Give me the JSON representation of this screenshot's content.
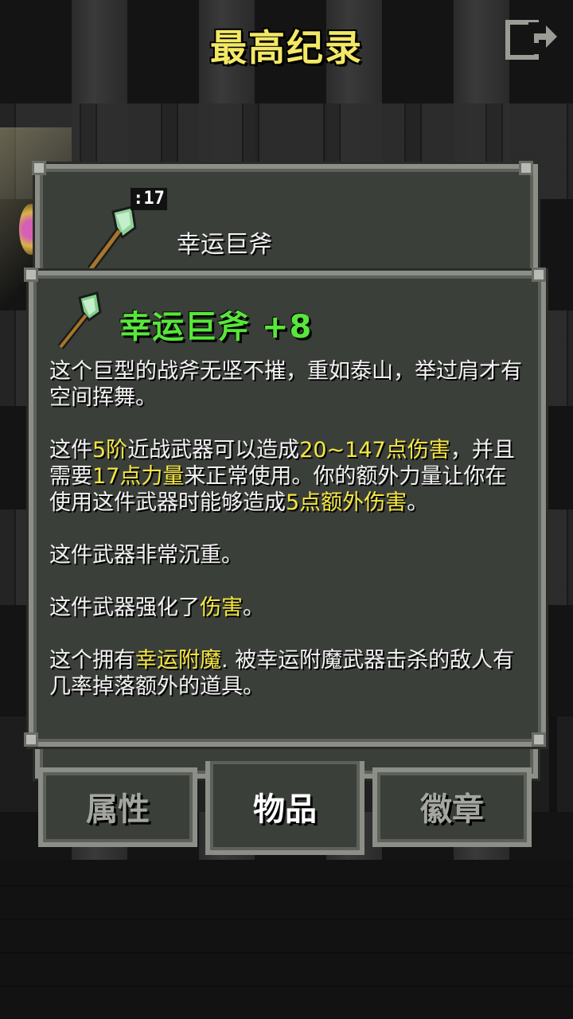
{
  "header": {
    "title": "最高纪录",
    "exit_icon": "exit-door-icon"
  },
  "back_panel": {
    "item_name": "幸运巨斧",
    "badge": ":17",
    "item_icon": "greataxe-icon"
  },
  "item": {
    "title": "幸运巨斧 +8",
    "icon": "greataxe-icon",
    "desc1": "这个巨型的战斧无坚不摧，重如泰山，举过肩才有空间挥舞。",
    "d2_a": "这件",
    "d2_tier": "5阶",
    "d2_b": "近战武器可以造成",
    "d2_dmg": "20~147点伤害",
    "d2_c": "，并且需要",
    "d2_str": "17点力量",
    "d2_d": "来正常使用。你的额外力量让你在使用这件武器时能够造成",
    "d2_bonus": "5点额外伤害",
    "d2_e": "。",
    "desc3": "这件武器非常沉重。",
    "d4_a": "这件武器强化了",
    "d4_hl": "伤害",
    "d4_b": "。",
    "d5_a": "这个拥有",
    "d5_hl": "幸运附魔",
    "d5_b": ". 被幸运附魔武器击杀的敌人有几率掉落额外的道具。"
  },
  "tabs": [
    {
      "label": "属性",
      "active": false
    },
    {
      "label": "物品",
      "active": true
    },
    {
      "label": "徽章",
      "active": false
    }
  ],
  "colors": {
    "title": "#f3e866",
    "item_name": "#58e63a",
    "highlight": "#f5e642",
    "panel": "#3b3f3a",
    "border": "#8c8f88"
  }
}
